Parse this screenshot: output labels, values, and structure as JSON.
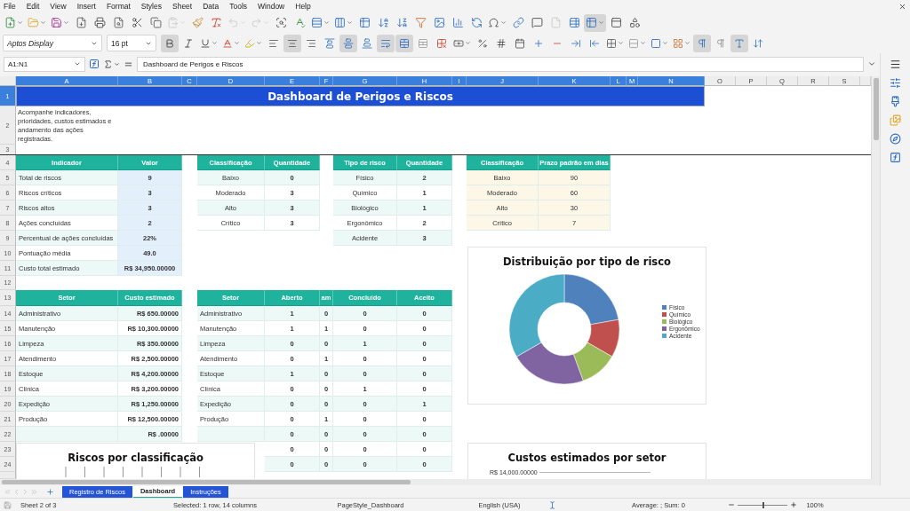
{
  "menu": [
    "File",
    "Edit",
    "View",
    "Insert",
    "Format",
    "Styles",
    "Sheet",
    "Data",
    "Tools",
    "Window",
    "Help"
  ],
  "toolbar_standard": [
    {
      "kind": "new",
      "active": false,
      "disabled": false
    },
    {
      "kind": "open",
      "active": false,
      "disabled": false
    },
    {
      "kind": "save",
      "active": false,
      "disabled": false
    },
    {
      "kind": "export-pdf",
      "active": false,
      "disabled": false
    },
    {
      "kind": "print",
      "active": false,
      "disabled": false
    },
    {
      "kind": "print-preview",
      "active": false,
      "disabled": false
    },
    {
      "kind": "cut",
      "active": false,
      "disabled": false
    },
    {
      "kind": "copy",
      "active": false,
      "disabled": false
    },
    {
      "kind": "paste",
      "active": false,
      "disabled": true
    },
    {
      "kind": "clone-format",
      "active": false,
      "disabled": false
    },
    {
      "kind": "clear-format",
      "active": false,
      "disabled": false
    },
    {
      "kind": "undo",
      "active": false,
      "disabled": true
    },
    {
      "kind": "redo",
      "active": false,
      "disabled": true
    },
    {
      "kind": "find",
      "active": false,
      "disabled": false
    },
    {
      "kind": "spelling",
      "active": false,
      "disabled": false
    },
    {
      "kind": "row",
      "active": false,
      "disabled": false
    },
    {
      "kind": "column",
      "active": false,
      "disabled": false
    },
    {
      "kind": "sort",
      "active": false,
      "disabled": false
    },
    {
      "kind": "sort-asc",
      "active": false,
      "disabled": false
    },
    {
      "kind": "sort-desc",
      "active": false,
      "disabled": false
    },
    {
      "kind": "autofilter",
      "active": false,
      "disabled": false
    },
    {
      "kind": "image",
      "active": false,
      "disabled": false
    },
    {
      "kind": "chart",
      "active": false,
      "disabled": false
    },
    {
      "kind": "pivot",
      "active": false,
      "disabled": false
    },
    {
      "kind": "special-character",
      "active": false,
      "disabled": false
    },
    {
      "kind": "hyperlink",
      "active": false,
      "disabled": false
    },
    {
      "kind": "comment",
      "active": false,
      "disabled": false
    },
    {
      "kind": "header-footer",
      "active": false,
      "disabled": true
    },
    {
      "kind": "define-print-area",
      "active": false,
      "disabled": false
    },
    {
      "kind": "freeze",
      "active": true,
      "disabled": false
    },
    {
      "kind": "split",
      "active": false,
      "disabled": false
    },
    {
      "kind": "shapes",
      "active": false,
      "disabled": false
    }
  ],
  "toolbar_format": {
    "font": "Aptos Display",
    "size": "16 pt",
    "buttons": [
      {
        "kind": "bold",
        "active": true
      },
      {
        "kind": "italic",
        "active": false
      },
      {
        "kind": "underline",
        "active": false
      },
      {
        "kind": "font-color",
        "active": false
      },
      {
        "kind": "highlight",
        "active": false
      },
      {
        "kind": "align-left",
        "active": false
      },
      {
        "kind": "align-center",
        "active": true
      },
      {
        "kind": "align-right",
        "active": false
      },
      {
        "kind": "align-top",
        "active": false
      },
      {
        "kind": "align-middle",
        "active": true
      },
      {
        "kind": "align-bottom",
        "active": false
      },
      {
        "kind": "wrap",
        "active": true
      },
      {
        "kind": "merge",
        "active": true
      },
      {
        "kind": "unmerge",
        "active": false
      },
      {
        "kind": "split-cells",
        "active": false
      },
      {
        "kind": "currency",
        "active": false
      },
      {
        "kind": "percent",
        "active": false
      },
      {
        "kind": "number",
        "active": false
      },
      {
        "kind": "date",
        "active": false
      },
      {
        "kind": "add-decimal",
        "active": false
      },
      {
        "kind": "delete-decimal",
        "active": false
      },
      {
        "kind": "indent",
        "active": false
      },
      {
        "kind": "outdent",
        "active": false
      },
      {
        "kind": "borders",
        "active": false
      },
      {
        "kind": "border-style",
        "active": false
      },
      {
        "kind": "border-color",
        "active": false
      },
      {
        "kind": "conditional",
        "active": false
      },
      {
        "kind": "left-to-right",
        "active": true
      },
      {
        "kind": "right-to-left",
        "active": false
      },
      {
        "kind": "wrap-text-direction",
        "active": true
      },
      {
        "kind": "vertical-text",
        "active": false
      }
    ]
  },
  "formula_bar": {
    "name_box": "A1:N1",
    "content": "Dashboard de Perigos e Riscos"
  },
  "columns": [
    {
      "label": "A",
      "selected": true
    },
    {
      "label": "B",
      "selected": true
    },
    {
      "label": "C",
      "selected": true
    },
    {
      "label": "D",
      "selected": true
    },
    {
      "label": "E",
      "selected": true
    },
    {
      "label": "F",
      "selected": true
    },
    {
      "label": "G",
      "selected": true
    },
    {
      "label": "H",
      "selected": true
    },
    {
      "label": "I",
      "selected": true
    },
    {
      "label": "J",
      "selected": true
    },
    {
      "label": "K",
      "selected": true
    },
    {
      "label": "L",
      "selected": true
    },
    {
      "label": "M",
      "selected": true
    },
    {
      "label": "N",
      "selected": true
    },
    {
      "label": "O",
      "selected": false
    },
    {
      "label": "P",
      "selected": false
    },
    {
      "label": "Q",
      "selected": false
    },
    {
      "label": "R",
      "selected": false
    },
    {
      "label": "S",
      "selected": false
    }
  ],
  "rows": [
    {
      "label": "1",
      "selected": true
    },
    {
      "label": "2",
      "selected": false
    },
    {
      "label": "3",
      "selected": false
    },
    {
      "label": "4",
      "selected": false
    },
    {
      "label": "5",
      "selected": false
    },
    {
      "label": "6",
      "selected": false
    },
    {
      "label": "7",
      "selected": false
    },
    {
      "label": "8",
      "selected": false
    },
    {
      "label": "9",
      "selected": false
    },
    {
      "label": "10",
      "selected": false
    },
    {
      "label": "11",
      "selected": false
    },
    {
      "label": "12",
      "selected": false
    },
    {
      "label": "13",
      "selected": false
    },
    {
      "label": "14",
      "selected": false
    },
    {
      "label": "15",
      "selected": false
    },
    {
      "label": "16",
      "selected": false
    },
    {
      "label": "17",
      "selected": false
    },
    {
      "label": "18",
      "selected": false
    },
    {
      "label": "19",
      "selected": false
    },
    {
      "label": "20",
      "selected": false
    },
    {
      "label": "21",
      "selected": false
    },
    {
      "label": "22",
      "selected": false
    },
    {
      "label": "23",
      "selected": false
    },
    {
      "label": "24",
      "selected": false
    }
  ],
  "title": "Dashboard de Perigos e Riscos",
  "intro": "Acompanhe indicadores, prioridades, custos estimados e andamento das ações registradas.",
  "indicators": {
    "columns": [
      "Indicador",
      "Valor"
    ],
    "rows": [
      [
        "Total de riscos",
        "9"
      ],
      [
        "Riscos críticos",
        "3"
      ],
      [
        "Riscos altos",
        "3"
      ],
      [
        "Ações concluídas",
        "2"
      ],
      [
        "Percentual de ações concluídas",
        "22%"
      ],
      [
        "Pontuação média",
        "49.0"
      ],
      [
        "Custo total estimado",
        "R$ 34,950.00000"
      ]
    ]
  },
  "by_classification": {
    "columns": [
      "Classificação",
      "Quantidade"
    ],
    "rows": [
      [
        "Baixo",
        "0"
      ],
      [
        "Moderado",
        "3"
      ],
      [
        "Alto",
        "3"
      ],
      [
        "Crítico",
        "3"
      ]
    ]
  },
  "by_type": {
    "columns": [
      "Tipo de risco",
      "Quantidade"
    ],
    "rows": [
      [
        "Físico",
        "2"
      ],
      [
        "Químico",
        "1"
      ],
      [
        "Biológico",
        "1"
      ],
      [
        "Ergonômico",
        "2"
      ],
      [
        "Acidente",
        "3"
      ]
    ]
  },
  "deadlines": {
    "columns": [
      "Classificação",
      "Prazo padrão em dias"
    ],
    "rows": [
      [
        "Baixo",
        "90"
      ],
      [
        "Moderado",
        "60"
      ],
      [
        "Alto",
        "30"
      ],
      [
        "Crítico",
        "7"
      ]
    ]
  },
  "cost_by_sector": {
    "columns": [
      "Setor",
      "Custo estimado"
    ],
    "rows": [
      {
        "setor": "Administrativo",
        "custo": "R$ 650.00000"
      },
      {
        "setor": "Manutenção",
        "custo": "R$ 10,300.00000"
      },
      {
        "setor": "Limpeza",
        "custo": "R$ 350.00000"
      },
      {
        "setor": "Atendimento",
        "custo": "R$ 2,500.00000"
      },
      {
        "setor": "Estoque",
        "custo": "R$ 4,200.00000"
      },
      {
        "setor": "Clínica",
        "custo": "R$ 3,200.00000"
      },
      {
        "setor": "Expedição",
        "custo": "R$ 1,250.00000"
      },
      {
        "setor": "Produção",
        "custo": "R$ 12,500.00000"
      },
      {
        "custo": "R$ .00000"
      }
    ]
  },
  "status_by_sector": {
    "columns": [
      "Setor",
      "Aberto",
      "am",
      "Concluído",
      "Aceito"
    ],
    "rows": [
      {
        "setor": "Administrativo",
        "values": [
          "1",
          "0",
          "0",
          "0"
        ]
      },
      {
        "setor": "Manutenção",
        "values": [
          "1",
          "1",
          "0",
          "0"
        ]
      },
      {
        "setor": "Limpeza",
        "values": [
          "0",
          "0",
          "1",
          "0"
        ]
      },
      {
        "setor": "Atendimento",
        "values": [
          "0",
          "1",
          "0",
          "0"
        ]
      },
      {
        "setor": "Estoque",
        "values": [
          "1",
          "0",
          "0",
          "0"
        ]
      },
      {
        "setor": "Clínica",
        "values": [
          "0",
          "0",
          "1",
          "0"
        ]
      },
      {
        "setor": "Expedição",
        "values": [
          "0",
          "0",
          "0",
          "1"
        ]
      },
      {
        "setor": "Produção",
        "values": [
          "0",
          "1",
          "0",
          "0"
        ]
      },
      {
        "values": [
          "0",
          "0",
          "0",
          "0"
        ]
      },
      {
        "values": [
          "0",
          "0",
          "0",
          "0"
        ]
      },
      {
        "values": [
          "0",
          "0",
          "0",
          "0"
        ]
      }
    ]
  },
  "type_chart": {
    "title": "Distribuição por tipo de risco",
    "chart_data": {
      "type": "donut",
      "categories": [
        "Físico",
        "Químico",
        "Biológico",
        "Ergonômico",
        "Acidente"
      ],
      "series": [
        {
          "values": [
            22.22,
            11.11,
            11.11,
            22.22,
            33.34
          ]
        }
      ]
    }
  },
  "classification_chart": {
    "title": "Riscos por classificação"
  },
  "cost_chart": {
    "title": "Custos estimados por setor",
    "axis_label": "R$ 14,000.00000"
  },
  "sheet_tabs": [
    {
      "label": "Registro de Riscos",
      "selected": false
    },
    {
      "label": "Dashboard",
      "selected": true
    },
    {
      "label": "Instruções",
      "selected": false
    }
  ],
  "status_bar": {
    "sheet": "Sheet 2 of 3",
    "selection": "Selected: 1 row, 14 columns",
    "page_style": "PageStyle_Dashboard",
    "language": "English (USA)",
    "summary": "Average: ; Sum: 0",
    "zoom": {
      "level": 0.5,
      "label": "100%"
    }
  }
}
